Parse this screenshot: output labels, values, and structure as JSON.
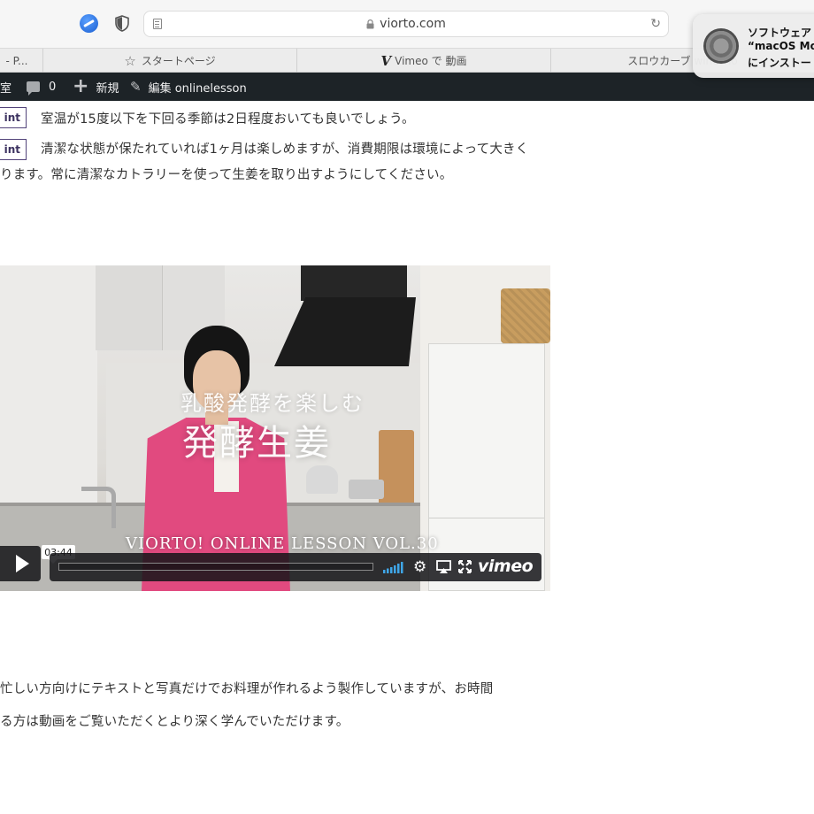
{
  "browser": {
    "url": "viorto.com",
    "bookmarks": [
      {
        "label": "- P..."
      },
      {
        "label": "スタートページ",
        "icon": "star-icon"
      },
      {
        "label": "Vimeo で 動画",
        "icon": "vimeo-v-icon"
      },
      {
        "label": "スロウカーブ winesho"
      }
    ]
  },
  "notification": {
    "title": "ソフトウェア",
    "line2": "“macOS Mon",
    "line3": "にインストー"
  },
  "adminbar": {
    "site_fragment": "室",
    "comments_count": "0",
    "new_label": "新規",
    "edit_label": "編集 onlinelesson"
  },
  "content": {
    "point_label": "int",
    "point1_text": "室温が15度以下を下回る季節は2日程度おいても良いでしょう。",
    "point2_text": "清潔な状態が保たれていれば1ヶ月は楽しめますが、消費期限は環境によって大きく",
    "point2_cont": "ります。常に清潔なカトラリーを使って生姜を取り出すようにしてください。",
    "para1": "忙しい方向けにテキストと写真だけでお料理が作れるよう製作していますが、お時間",
    "para2": "る方は動画をご覧いただくとより深く学んでいただけます。"
  },
  "video": {
    "subtitle": "乳酸発酵を楽しむ",
    "title": "発酵生姜",
    "lesson": "VIORTO! ONLINE LESSON VOL.30",
    "time": "03:44",
    "brand": "vimeo",
    "progress": 0
  }
}
